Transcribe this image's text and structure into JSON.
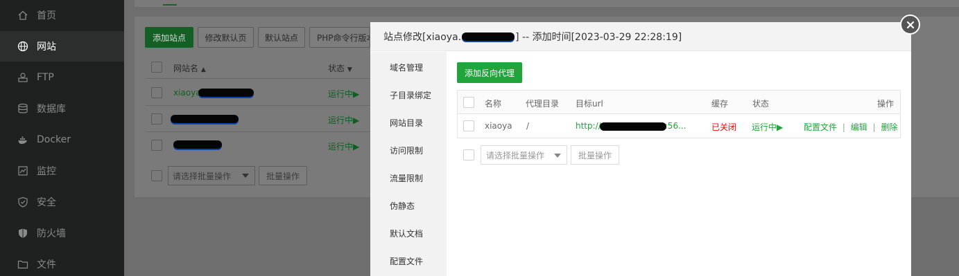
{
  "sidebar": {
    "items": [
      {
        "label": "首页",
        "icon": "home-icon"
      },
      {
        "label": "网站",
        "icon": "globe-icon",
        "active": true
      },
      {
        "label": "FTP",
        "icon": "ftp-icon"
      },
      {
        "label": "数据库",
        "icon": "database-icon"
      },
      {
        "label": "Docker",
        "icon": "docker-icon"
      },
      {
        "label": "监控",
        "icon": "monitor-icon"
      },
      {
        "label": "安全",
        "icon": "shield-check-icon"
      },
      {
        "label": "防火墙",
        "icon": "firewall-shield-icon"
      },
      {
        "label": "文件",
        "icon": "folder-icon"
      }
    ]
  },
  "background_page": {
    "toolbar": {
      "add_site": "添加站点",
      "edit_default_page": "修改默认页",
      "default_site": "默认站点",
      "php_cli": "PHP命令行版本"
    },
    "table": {
      "col_name": "网站名",
      "col_status": "状态",
      "rows": [
        {
          "name": "xiaoya",
          "status": "运行中▶"
        },
        {
          "name": "",
          "status": "运行中▶"
        },
        {
          "name": "",
          "status": "运行中▶"
        }
      ]
    },
    "batch_select_placeholder": "请选择批量操作",
    "batch_button": "批量操作"
  },
  "modal": {
    "title_prefix": "站点修改[xiaoya.",
    "title_suffix": "] -- 添加时间[2023-03-29 22:28:19]",
    "side_menu": [
      "域名管理",
      "子目录绑定",
      "网站目录",
      "访问限制",
      "流量限制",
      "伪静态",
      "默认文档",
      "配置文件"
    ],
    "add_proxy_button": "添加反向代理",
    "proxy_table": {
      "headers": {
        "name": "名称",
        "proxy_dir": "代理目录",
        "target_url": "目标url",
        "cache": "缓存",
        "status": "状态",
        "actions": "操作"
      },
      "rows": [
        {
          "name": "xiaoya",
          "proxy_dir": "/",
          "target_url_prefix": "http://",
          "target_url_suffix": ":56...",
          "cache": "已关闭",
          "status": "运行中▶",
          "action_config": "配置文件",
          "action_edit": "编辑",
          "action_delete": "删除",
          "separator": "|"
        }
      ]
    },
    "batch_select_placeholder": "请选择批量操作",
    "batch_button": "批量操作"
  },
  "colors": {
    "accent_green": "#20a53a",
    "danger_red": "#ef0808",
    "sidebar_bg": "#1f2020"
  }
}
